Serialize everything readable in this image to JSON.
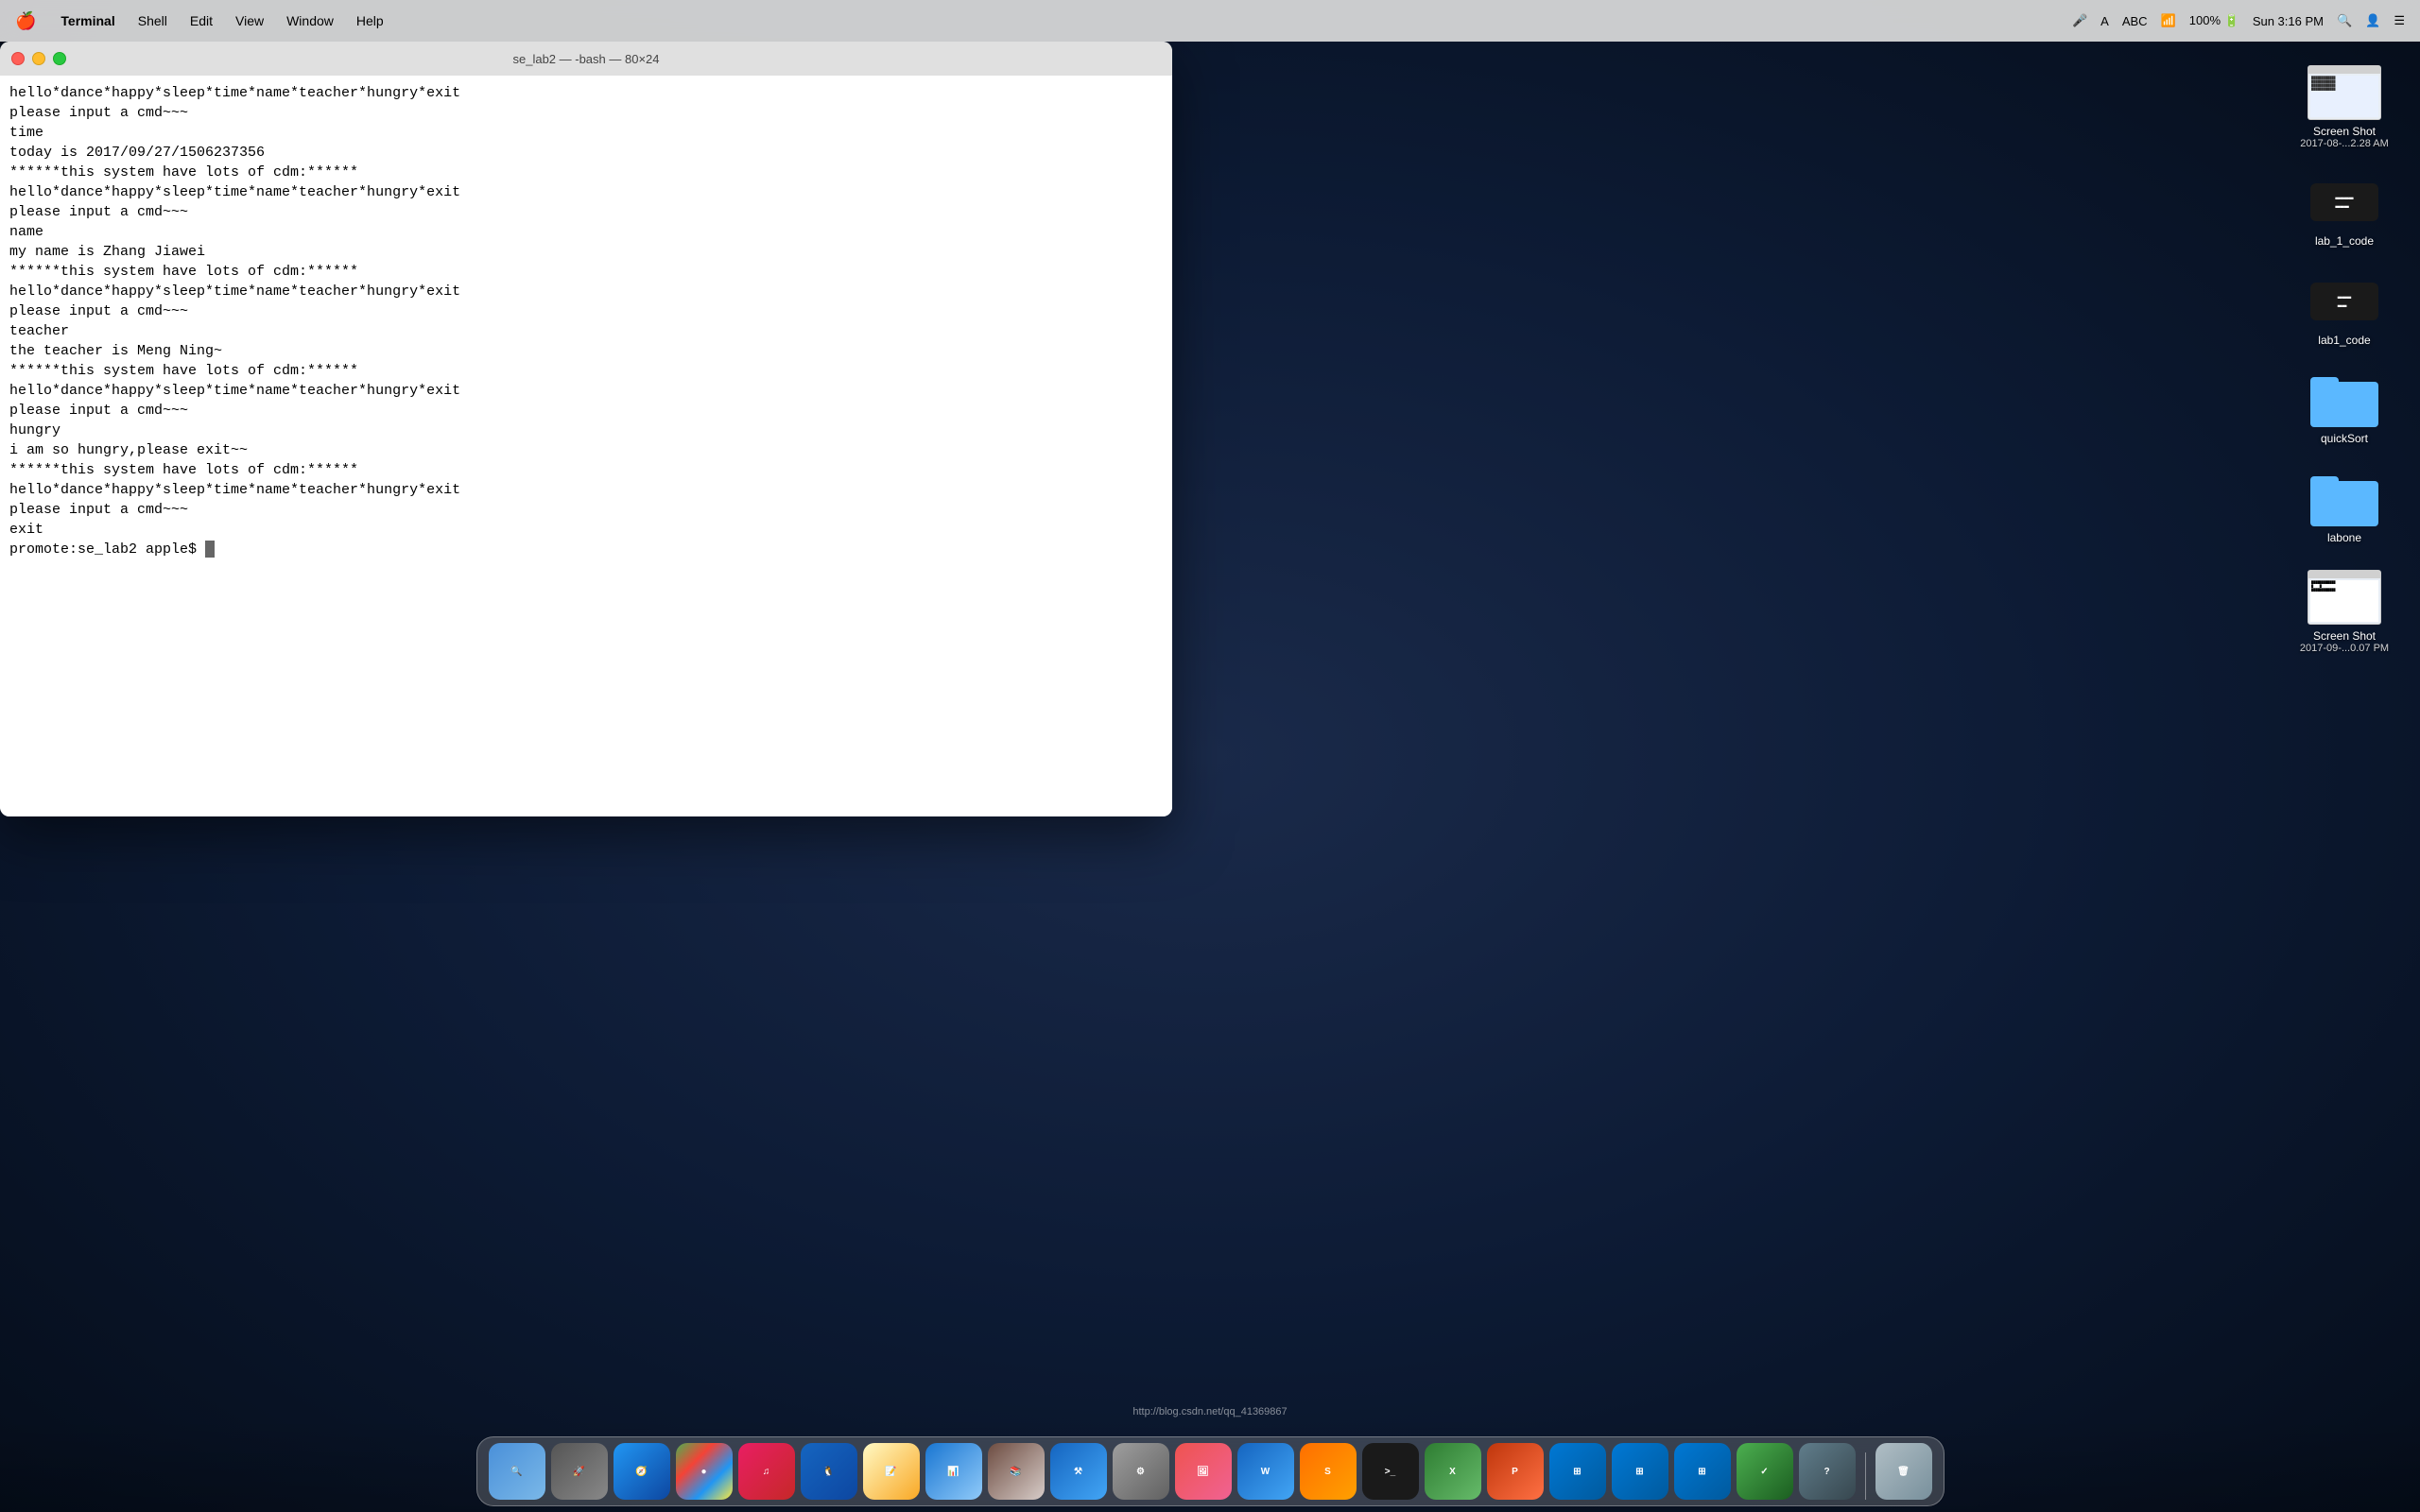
{
  "menubar": {
    "apple": "🍎",
    "appName": "Terminal",
    "items": [
      "Terminal",
      "Shell",
      "Edit",
      "View",
      "Window",
      "Help"
    ],
    "right": {
      "wifi": "📶",
      "battery": "100%",
      "time": "Sun 3:16 PM"
    }
  },
  "terminal": {
    "title": "se_lab2 — -bash — 80×24",
    "content": [
      "hello*dance*happy*sleep*time*name*teacher*hungry*exit",
      "please input a cmd~~~",
      "time",
      "today is 2017/09/27/1506237356",
      "******this system have lots of cdm:******",
      "hello*dance*happy*sleep*time*name*teacher*hungry*exit",
      "please input a cmd~~~",
      "name",
      "my name is Zhang Jiawei",
      "******this system have lots of cdm:******",
      "hello*dance*happy*sleep*time*name*teacher*hungry*exit",
      "please input a cmd~~~",
      "teacher",
      "the teacher is Meng Ning~",
      "******this system have lots of cdm:******",
      "hello*dance*happy*sleep*time*name*teacher*hungry*exit",
      "please input a cmd~~~",
      "hungry",
      "i am so hungry,please exit~~",
      "******this system have lots of cdm:******",
      "hello*dance*happy*sleep*time*name*teacher*hungry*exit",
      "please input a cmd~~~",
      "exit",
      "promote:se_lab2 apple$ "
    ],
    "prompt": "promote:se_lab2 apple$ "
  },
  "desktop_icons": [
    {
      "name": "screenshot1",
      "label": "Screen Shot",
      "sublabel": "2017-08-...2.28 AM",
      "type": "screenshot"
    },
    {
      "name": "lab1code1",
      "label": "lab_1_code",
      "sublabel": "",
      "type": "file"
    },
    {
      "name": "lab1code2",
      "label": "lab1_code",
      "sublabel": "",
      "type": "file"
    },
    {
      "name": "quickSort",
      "label": "quickSort",
      "sublabel": "",
      "type": "folder"
    },
    {
      "name": "labone",
      "label": "labone",
      "sublabel": "",
      "type": "folder"
    },
    {
      "name": "screenshot2",
      "label": "Screen Shot",
      "sublabel": "2017-09-...0.07 PM",
      "type": "screenshot"
    }
  ],
  "dock": {
    "items": [
      {
        "name": "finder",
        "label": "Finder",
        "class": "dock-finder",
        "icon": "🔍"
      },
      {
        "name": "launchpad",
        "label": "Launchpad",
        "class": "dock-launchpad",
        "icon": "🚀"
      },
      {
        "name": "safari",
        "label": "Safari",
        "class": "dock-safari",
        "icon": "🧭"
      },
      {
        "name": "chrome",
        "label": "Chrome",
        "class": "dock-chrome",
        "icon": "●"
      },
      {
        "name": "music",
        "label": "Music",
        "class": "dock-music",
        "icon": "♫"
      },
      {
        "name": "qq",
        "label": "QQ",
        "class": "dock-qq",
        "icon": "🐧"
      },
      {
        "name": "notes",
        "label": "Notes",
        "class": "dock-notes",
        "icon": "📝"
      },
      {
        "name": "keynote",
        "label": "Keynote",
        "class": "dock-keynote",
        "icon": "📊"
      },
      {
        "name": "ibooks",
        "label": "iBooks",
        "class": "dock-ibooks",
        "icon": "📚"
      },
      {
        "name": "xcode",
        "label": "Xcode",
        "class": "dock-xcode",
        "icon": "⚒"
      },
      {
        "name": "system",
        "label": "System Prefs",
        "class": "dock-system",
        "icon": "⚙"
      },
      {
        "name": "preview",
        "label": "Preview",
        "class": "dock-preview",
        "icon": "🖼"
      },
      {
        "name": "word",
        "label": "Word",
        "class": "dock-word",
        "icon": "W"
      },
      {
        "name": "sublime",
        "label": "Sublime",
        "class": "dock-sublime",
        "icon": "S"
      },
      {
        "name": "terminal",
        "label": "Terminal",
        "class": "dock-terminal",
        "icon": ">_"
      },
      {
        "name": "excel",
        "label": "Excel",
        "class": "dock-excel",
        "icon": "X"
      },
      {
        "name": "ppt",
        "label": "PowerPoint",
        "class": "dock-ppt",
        "icon": "P"
      },
      {
        "name": "windows",
        "label": "Windows",
        "class": "dock-windows",
        "icon": "⊞"
      },
      {
        "name": "windows2",
        "label": "Windows2",
        "class": "dock-windows2",
        "icon": "⊞"
      },
      {
        "name": "windows3",
        "label": "Windows3",
        "class": "dock-windows3",
        "icon": "⊞"
      },
      {
        "name": "task",
        "label": "Tasks",
        "class": "dock-task",
        "icon": "✓"
      },
      {
        "name": "unknown",
        "label": "App",
        "class": "dock-unknown",
        "icon": "?"
      },
      {
        "name": "trash",
        "label": "Trash",
        "class": "dock-trash",
        "icon": "🗑"
      }
    ]
  },
  "status_link": "http://blog.csdn.net/qq_41369867"
}
